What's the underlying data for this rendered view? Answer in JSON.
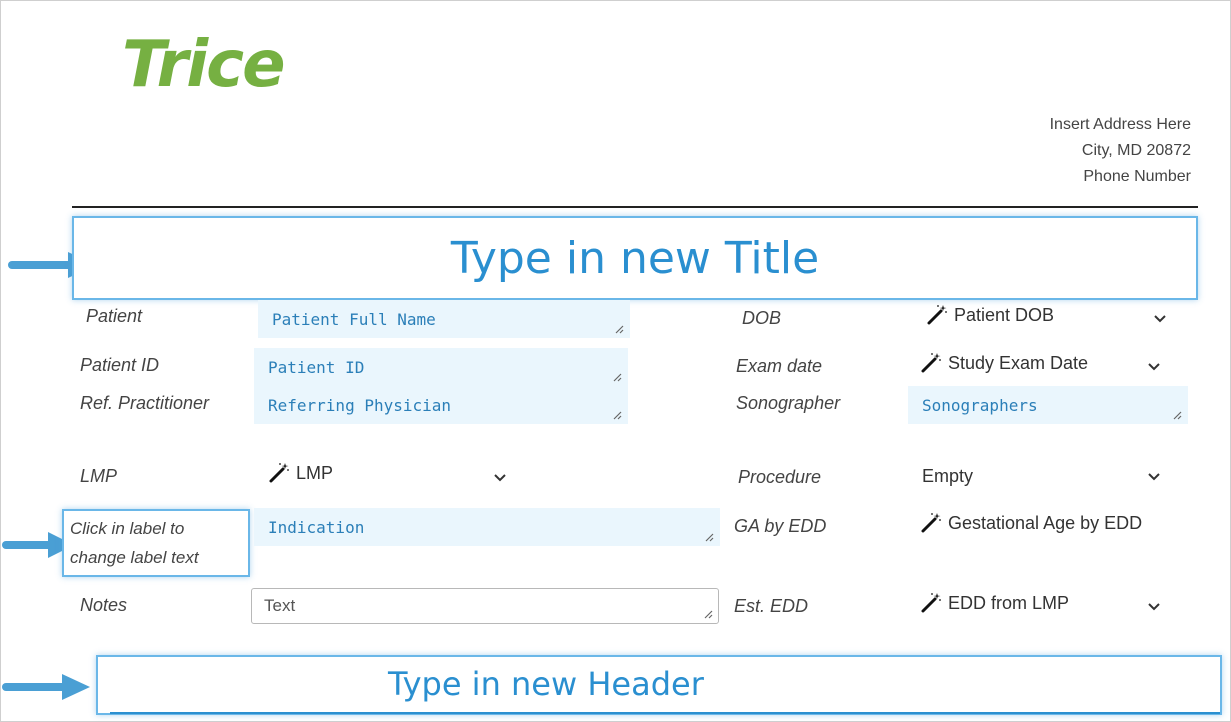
{
  "logo": {
    "text": "Trice",
    "color": "#76b042"
  },
  "address": {
    "line1": "Insert Address Here",
    "line2": "City, MD 20872",
    "line3": "Phone Number"
  },
  "title": "Type in new Title",
  "left_fields": {
    "patient": {
      "label": "Patient",
      "value": "Patient Full Name"
    },
    "patient_id": {
      "label": "Patient ID",
      "value": "Patient ID"
    },
    "ref_practitioner": {
      "label": "Ref. Practitioner",
      "value": "Referring Physician"
    },
    "lmp": {
      "label": "LMP",
      "value": "LMP"
    },
    "indication": {
      "label_line1": "Click in label to",
      "label_line2": "change label text",
      "value": "Indication"
    },
    "notes": {
      "label": "Notes",
      "value": "Text"
    }
  },
  "right_fields": {
    "dob": {
      "label": "DOB",
      "value": "Patient DOB"
    },
    "exam_date": {
      "label": "Exam date",
      "value": "Study Exam Date"
    },
    "sonographer": {
      "label": "Sonographer",
      "value": "Sonographers"
    },
    "procedure": {
      "label": "Procedure",
      "value": "Empty"
    },
    "ga_by_edd": {
      "label": "GA by EDD",
      "value": "Gestational Age by EDD"
    },
    "est_edd": {
      "label": "Est. EDD",
      "value": "EDD from LMP"
    }
  },
  "header": "Type in new Header",
  "colors": {
    "accent": "#2a8fd0",
    "field_bg": "#eaf6fd",
    "arrow": "#4a9fd4"
  },
  "icons": [
    "magic-wand-icon",
    "chevron-down-icon",
    "arrow-right-icon",
    "resize-grip-icon"
  ]
}
